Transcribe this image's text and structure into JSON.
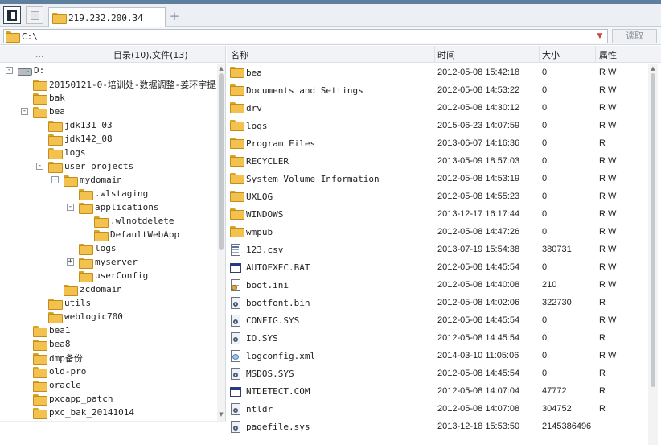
{
  "tabs": {
    "active_label": "219.232.200.34",
    "add_label": "+"
  },
  "address": {
    "path": "C:\\",
    "read_label": "读取"
  },
  "left_panel": {
    "dots": "...",
    "summary": "目录(10),文件(13)",
    "tree": [
      {
        "label": "D:",
        "depth": 0,
        "icon": "drive-icon",
        "expander": "-"
      },
      {
        "label": "20150121-0-培训处-数据调整-姜环宇提",
        "depth": 1,
        "icon": "folder-icon",
        "expander": ""
      },
      {
        "label": "bak",
        "depth": 1,
        "icon": "folder-icon",
        "expander": ""
      },
      {
        "label": "bea",
        "depth": 1,
        "icon": "folder-icon",
        "expander": "-"
      },
      {
        "label": "jdk131_03",
        "depth": 2,
        "icon": "folder-icon",
        "expander": ""
      },
      {
        "label": "jdk142_08",
        "depth": 2,
        "icon": "folder-icon",
        "expander": ""
      },
      {
        "label": "logs",
        "depth": 2,
        "icon": "folder-icon",
        "expander": ""
      },
      {
        "label": "user_projects",
        "depth": 2,
        "icon": "folder-icon",
        "expander": "-"
      },
      {
        "label": "mydomain",
        "depth": 3,
        "icon": "folder-icon",
        "expander": "-"
      },
      {
        "label": ".wlstaging",
        "depth": 4,
        "icon": "folder-icon",
        "expander": ""
      },
      {
        "label": "applications",
        "depth": 4,
        "icon": "folder-icon",
        "expander": "-"
      },
      {
        "label": ".wlnotdelete",
        "depth": 5,
        "icon": "folder-icon",
        "expander": ""
      },
      {
        "label": "DefaultWebApp",
        "depth": 5,
        "icon": "folder-icon",
        "expander": ""
      },
      {
        "label": "logs",
        "depth": 4,
        "icon": "folder-icon",
        "expander": ""
      },
      {
        "label": "myserver",
        "depth": 4,
        "icon": "folder-icon",
        "expander": "+"
      },
      {
        "label": "userConfig",
        "depth": 4,
        "icon": "folder-icon",
        "expander": ""
      },
      {
        "label": "zcdomain",
        "depth": 3,
        "icon": "folder-icon",
        "expander": ""
      },
      {
        "label": "utils",
        "depth": 2,
        "icon": "folder-icon",
        "expander": ""
      },
      {
        "label": "weblogic700",
        "depth": 2,
        "icon": "folder-icon",
        "expander": ""
      },
      {
        "label": "bea1",
        "depth": 1,
        "icon": "folder-icon",
        "expander": ""
      },
      {
        "label": "bea8",
        "depth": 1,
        "icon": "folder-icon",
        "expander": ""
      },
      {
        "label": "dmp备份",
        "depth": 1,
        "icon": "folder-icon",
        "expander": ""
      },
      {
        "label": "old-pro",
        "depth": 1,
        "icon": "folder-icon",
        "expander": ""
      },
      {
        "label": "oracle",
        "depth": 1,
        "icon": "folder-icon",
        "expander": ""
      },
      {
        "label": "pxcapp_patch",
        "depth": 1,
        "icon": "folder-icon",
        "expander": ""
      },
      {
        "label": "pxc_bak_20141014",
        "depth": 1,
        "icon": "folder-icon",
        "expander": ""
      }
    ]
  },
  "file_list": {
    "columns": [
      "名称",
      "时间",
      "大小",
      "属性"
    ],
    "rows": [
      {
        "name": "bea",
        "time": "2012-05-08 15:42:18",
        "size": "0",
        "attr": "R W",
        "icon": "folder-icon"
      },
      {
        "name": "Documents and Settings",
        "time": "2012-05-08 14:53:22",
        "size": "0",
        "attr": "R W",
        "icon": "folder-icon"
      },
      {
        "name": "drv",
        "time": "2012-05-08 14:30:12",
        "size": "0",
        "attr": "R W",
        "icon": "folder-icon"
      },
      {
        "name": "logs",
        "time": "2015-06-23 14:07:59",
        "size": "0",
        "attr": "R W",
        "icon": "folder-icon"
      },
      {
        "name": "Program Files",
        "time": "2013-06-07 14:16:36",
        "size": "0",
        "attr": "R",
        "icon": "folder-icon"
      },
      {
        "name": "RECYCLER",
        "time": "2013-05-09 18:57:03",
        "size": "0",
        "attr": "R W",
        "icon": "folder-icon"
      },
      {
        "name": "System Volume Information",
        "time": "2012-05-08 14:53:19",
        "size": "0",
        "attr": "R W",
        "icon": "folder-icon"
      },
      {
        "name": "UXLOG",
        "time": "2012-05-08 14:55:23",
        "size": "0",
        "attr": "R W",
        "icon": "folder-icon"
      },
      {
        "name": "WINDOWS",
        "time": "2013-12-17 16:17:44",
        "size": "0",
        "attr": "R W",
        "icon": "folder-icon"
      },
      {
        "name": "wmpub",
        "time": "2012-05-08 14:47:26",
        "size": "0",
        "attr": "R W",
        "icon": "folder-icon"
      },
      {
        "name": "123.csv",
        "time": "2013-07-19 15:54:38",
        "size": "380731",
        "attr": "R W",
        "icon": "text-file-icon"
      },
      {
        "name": "AUTOEXEC.BAT",
        "time": "2012-05-08 14:45:54",
        "size": "0",
        "attr": "R W",
        "icon": "batch-file-icon"
      },
      {
        "name": "boot.ini",
        "time": "2012-05-08 14:40:08",
        "size": "210",
        "attr": "R W",
        "icon": "ini-file-icon"
      },
      {
        "name": "bootfont.bin",
        "time": "2012-05-08 14:02:06",
        "size": "322730",
        "attr": "R",
        "icon": "system-file-icon"
      },
      {
        "name": "CONFIG.SYS",
        "time": "2012-05-08 14:45:54",
        "size": "0",
        "attr": "R W",
        "icon": "system-file-icon"
      },
      {
        "name": "IO.SYS",
        "time": "2012-05-08 14:45:54",
        "size": "0",
        "attr": "R",
        "icon": "system-file-icon"
      },
      {
        "name": "logconfig.xml",
        "time": "2014-03-10 11:05:06",
        "size": "0",
        "attr": "R W",
        "icon": "xml-file-icon"
      },
      {
        "name": "MSDOS.SYS",
        "time": "2012-05-08 14:45:54",
        "size": "0",
        "attr": "R",
        "icon": "system-file-icon"
      },
      {
        "name": "NTDETECT.COM",
        "time": "2012-05-08 14:07:04",
        "size": "47772",
        "attr": "R",
        "icon": "batch-file-icon"
      },
      {
        "name": "ntldr",
        "time": "2012-05-08 14:07:08",
        "size": "304752",
        "attr": "R",
        "icon": "system-file-icon"
      },
      {
        "name": "pagefile.sys",
        "time": "2013-12-18 15:53:50",
        "size": "2145386496",
        "attr": "",
        "icon": "system-file-icon"
      }
    ]
  }
}
